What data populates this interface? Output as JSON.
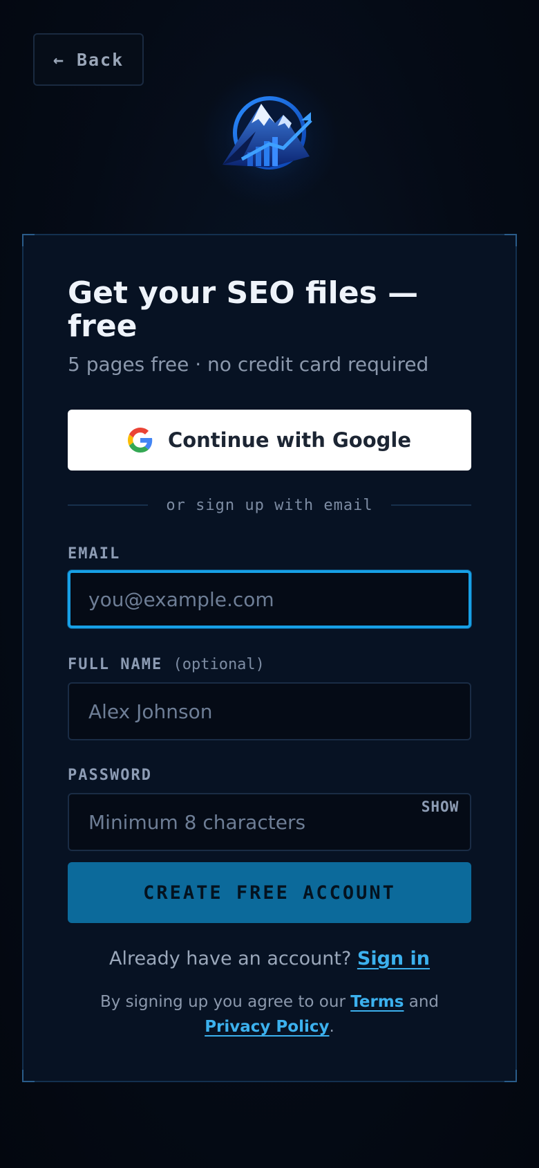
{
  "header": {
    "back_label": "← Back"
  },
  "card": {
    "title": "Get your SEO files — free",
    "subtitle": "5 pages free · no credit card required",
    "google_button_label": "Continue with Google",
    "divider_text": "or sign up with email",
    "email": {
      "label": "EMAIL",
      "placeholder": "you@example.com",
      "value": ""
    },
    "full_name": {
      "label": "FULL NAME",
      "optional_hint": "(optional)",
      "placeholder": "Alex Johnson",
      "value": ""
    },
    "password": {
      "label": "PASSWORD",
      "placeholder": "Minimum 8 characters",
      "show_label": "SHOW",
      "value": ""
    },
    "submit_label": "CREATE FREE ACCOUNT",
    "signin_prompt": "Already have an account?",
    "signin_link": "Sign in",
    "terms_prefix": "By signing up you agree to our",
    "terms_link": "Terms",
    "terms_and": "and",
    "privacy_link": "Privacy Policy",
    "terms_suffix": "."
  },
  "colors": {
    "accent": "#17a0e6",
    "cta_background": "#0c6a9b",
    "link": "#3cb1ee",
    "card_background": "#071223",
    "page_background": "#050b16"
  },
  "icons": {
    "logo": "mountain-growth-logo",
    "google": "google-g-icon"
  }
}
